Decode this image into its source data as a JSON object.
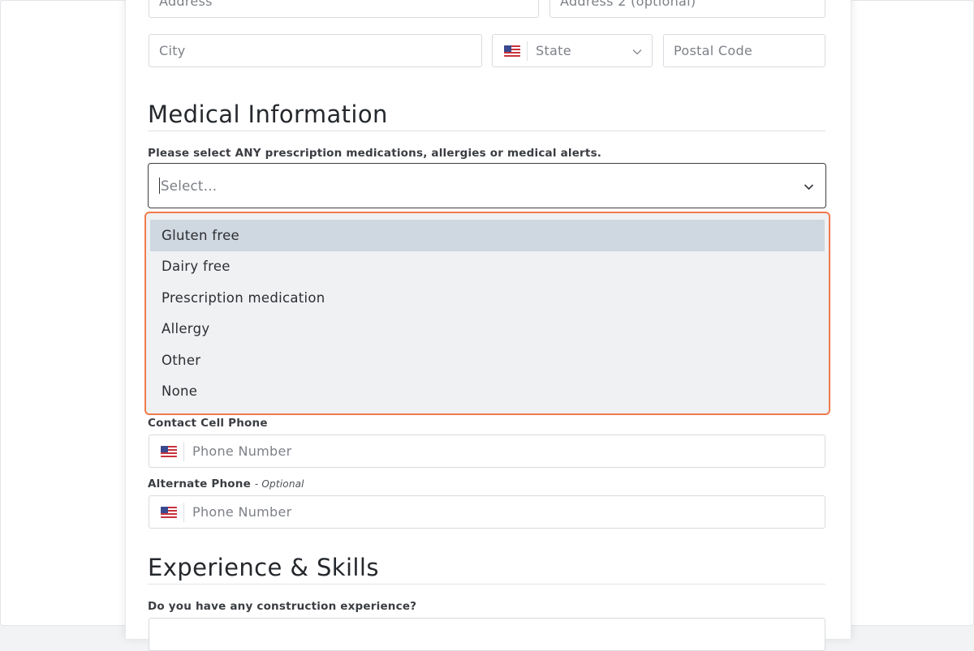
{
  "address": {
    "address_placeholder": "Address",
    "address2_placeholder": "Address 2 (optional)",
    "city_placeholder": "City",
    "state_placeholder": "State",
    "postal_placeholder": "Postal Code"
  },
  "medical": {
    "heading": "Medical Information",
    "question": "Please select ANY prescription medications, allergies or medical alerts.",
    "select_placeholder": "Select...",
    "options": [
      "Gluten free",
      "Dairy free",
      "Prescription medication",
      "Allergy",
      "Other",
      "None"
    ],
    "highlighted_option": "Gluten free"
  },
  "contact": {
    "cell_label": "Contact Cell Phone",
    "cell_placeholder": "Phone Number",
    "alt_label": "Alternate Phone",
    "alt_optional": "- Optional",
    "alt_placeholder": "Phone Number"
  },
  "experience": {
    "heading": "Experience & Skills",
    "question": "Do you have any construction experience?"
  },
  "colors": {
    "dropdown_border": "#f07a4b",
    "highlight": "#cfd7e0"
  },
  "icons": {
    "flag": "us-flag-icon",
    "chevron": "chevron-down-icon"
  }
}
